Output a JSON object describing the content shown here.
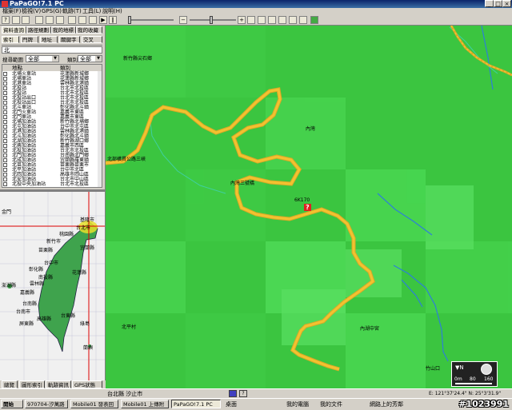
{
  "window": {
    "title": "PaPaGO!7.1 PC",
    "minimize": "_",
    "maximize": "□",
    "close": "×"
  },
  "menu": [
    "檔案(F)",
    "檢視(V)",
    "GPS(G)",
    "軌跡(T)",
    "工具(L)",
    "說明(H)"
  ],
  "left_tabs_row1": [
    "資料查詢",
    "路徑規劃",
    "我的地標",
    "我的收藏"
  ],
  "left_tabs_row2": [
    "索引",
    "門牌",
    "地址",
    "關鍵字",
    "交叉"
  ],
  "city_value": "北",
  "search_range_label": "搜尋範圍",
  "search_range_value": "全部",
  "category_label": "類別",
  "category_value": "全部",
  "poi_headers": [
    "地點",
    "類別"
  ],
  "poi_rows": [
    {
      "name": "北埔火車站",
      "cat": "花蓮縣新城鄉"
    },
    {
      "name": "北埔車站",
      "cat": "花蓮縣新城鄉"
    },
    {
      "name": "北港車站",
      "cat": "雲林縣北港鎮"
    },
    {
      "name": "北投站",
      "cat": "台北市北投區"
    },
    {
      "name": "北投站",
      "cat": "台北市北投區"
    },
    {
      "name": "北投站出口",
      "cat": "台北市北投區"
    },
    {
      "name": "北投站出口",
      "cat": "台北市北投區"
    },
    {
      "name": "北斗車站",
      "cat": "彰化縣北斗鎮"
    },
    {
      "name": "北門火車站",
      "cat": "嘉義市東區"
    },
    {
      "name": "北門車站",
      "cat": "嘉義市東區"
    },
    {
      "name": "北埔加油站",
      "cat": "新竹縣北埔鄉"
    },
    {
      "name": "北屯加油站",
      "cat": "台中市北屯區"
    },
    {
      "name": "北港加油站",
      "cat": "雲林縣北港鎮"
    },
    {
      "name": "北斗加油站",
      "cat": "彰化縣北斗鎮"
    },
    {
      "name": "北湖加油站",
      "cat": "新竹縣湖口鄉"
    },
    {
      "name": "北興加油站",
      "cat": "嘉義市西區"
    },
    {
      "name": "北投加油站",
      "cat": "台北市北投區"
    },
    {
      "name": "北門加油站",
      "cat": "台南縣北門鄉"
    },
    {
      "name": "北成加油站",
      "cat": "宜蘭縣羅東鎮"
    },
    {
      "name": "北苗加油站",
      "cat": "苗栗縣苗栗市"
    },
    {
      "name": "北平加油站",
      "cat": "台中市北區"
    },
    {
      "name": "北岡加油站",
      "cat": "高雄市岡山區"
    },
    {
      "name": "北安加油站",
      "cat": "台北市中山區"
    },
    {
      "name": "北投中央加油站",
      "cat": "台北市北投區"
    }
  ],
  "minimap_labels": [
    "台北市",
    "桃園縣",
    "新竹市",
    "苗栗縣",
    "台中市",
    "彰化縣",
    "南投縣",
    "雲林縣",
    "嘉義縣",
    "台南縣",
    "台南市",
    "高雄縣",
    "台東縣",
    "花蓮縣",
    "宜蘭縣",
    "屏東縣",
    "基隆市",
    "澎湖縣",
    "金門",
    "綠島",
    "蘭嶼"
  ],
  "bottom_tabs": [
    "總覽",
    "圖形索引",
    "軌跡資訊",
    "GPS狀態"
  ],
  "map_labels": [
    "北部橫貫公路三峽",
    "內灣三號橋",
    "6K170",
    "內湖中宮",
    "竹山口",
    "新竹縣尖石鄉",
    "北平村",
    "內灣"
  ],
  "scale_labels": [
    "0m",
    "80",
    "160"
  ],
  "status": {
    "location": "台北縣 汐止市",
    "coords": "E: 121°37'24.4\"  N: 25°3'31.9\""
  },
  "taskbar": {
    "start": "開始",
    "tasks": [
      "970704-汐萬路",
      "Mobile01 發表回",
      "Mobile01 上傳附",
      "PaPaGO!7.1 PC"
    ],
    "tray": [
      "桌面",
      "我的電腦",
      "我的文件",
      "網路上的芳鄰"
    ]
  },
  "watermark": "#1023991",
  "colors": {
    "map_bg": "#3bc540",
    "road": "#f2c230",
    "title_bar": "#0a246a"
  }
}
